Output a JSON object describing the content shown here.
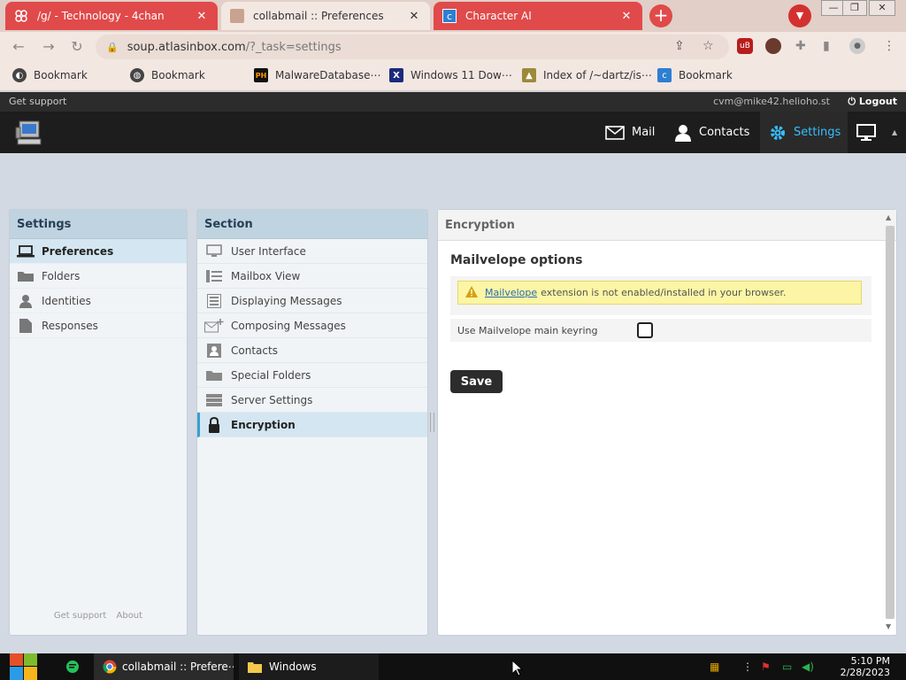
{
  "browser": {
    "tabs": [
      {
        "title": "/g/ - Technology - 4chan",
        "close": "✕"
      },
      {
        "title": "collabmail :: Preferences",
        "close": "✕"
      },
      {
        "title": "Character AI",
        "close": "✕"
      }
    ],
    "new_tab": "+",
    "window_controls": [
      "—",
      "❐",
      "✕"
    ],
    "url_host": "soup.atlasinbox.com",
    "url_path": "/?_task=settings",
    "extension_badge": "uB",
    "bookmarks": [
      {
        "label": "Bookmark"
      },
      {
        "label": "Bookmark"
      },
      {
        "label": "MalwareDatabase⋯"
      },
      {
        "label": "Windows 11 Dow⋯"
      },
      {
        "label": "Index of /~dartz/is⋯"
      },
      {
        "label": "Bookmark"
      }
    ]
  },
  "app": {
    "support_link": "Get support",
    "user_email": "cvm@mike42.helioho.st",
    "logout_label": "Logout",
    "nav": [
      {
        "label": "Mail"
      },
      {
        "label": "Contacts"
      },
      {
        "label": "Settings"
      }
    ],
    "settings_panel": {
      "title": "Settings",
      "items": [
        {
          "label": "Preferences"
        },
        {
          "label": "Folders"
        },
        {
          "label": "Identities"
        },
        {
          "label": "Responses"
        }
      ],
      "footer": [
        "Get support",
        "About"
      ]
    },
    "section_panel": {
      "title": "Section",
      "items": [
        {
          "label": "User Interface"
        },
        {
          "label": "Mailbox View"
        },
        {
          "label": "Displaying Messages"
        },
        {
          "label": "Composing Messages"
        },
        {
          "label": "Contacts"
        },
        {
          "label": "Special Folders"
        },
        {
          "label": "Server Settings"
        },
        {
          "label": "Encryption"
        }
      ]
    },
    "content": {
      "header": "Encryption",
      "heading": "Mailvelope options",
      "warning_link": "Mailvelope",
      "warning_text": "extension is not enabled/installed in your browser.",
      "option_label": "Use Mailvelope main keyring",
      "option_checked": false,
      "save_label": "Save"
    }
  },
  "taskbar": {
    "items": [
      {
        "label": "collabmail :: Prefere⋯"
      },
      {
        "label": "Windows"
      }
    ],
    "time": "5:10 PM",
    "date": "2/28/2023"
  },
  "colors": {
    "accent": "#37beff",
    "tab_red": "#e04a4a",
    "header_dark": "#1d1d1d",
    "panel_head": "#bfd3e0",
    "warning_bg": "#fbf5a5"
  }
}
